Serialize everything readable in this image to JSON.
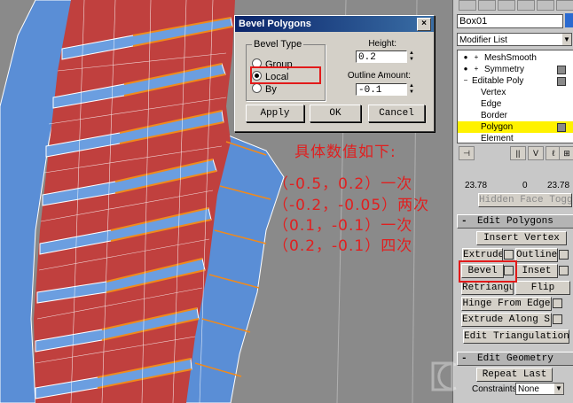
{
  "dialog": {
    "title": "Bevel Polygons",
    "close": "×",
    "bevel_type_legend": "Bevel Type",
    "options": [
      "Group",
      "Local",
      "By"
    ],
    "selected_option": "Local",
    "height_label": "Height:",
    "height_value": "0.2",
    "outline_label": "Outline Amount:",
    "outline_value": "-0.1",
    "apply": "Apply",
    "ok": "OK",
    "cancel": "Cancel"
  },
  "annotation": {
    "heading": "具体数值如下:",
    "lines": [
      "（-0.5，0.2）一次",
      "（-0.2，-0.05）两次",
      "（0.1，-0.1）一次",
      "（0.2，-0.1）四次"
    ]
  },
  "panel": {
    "object_name": "Box01",
    "object_color": "#2a6ad0",
    "modifier_list": "Modifier List",
    "stack": [
      {
        "label": "MeshSmooth",
        "selected": false
      },
      {
        "label": "Symmetry",
        "selected": false
      },
      {
        "label": "Editable Poly",
        "selected": false
      },
      {
        "label": "Vertex",
        "selected": false
      },
      {
        "label": "Edge",
        "selected": false
      },
      {
        "label": "Border",
        "selected": false
      },
      {
        "label": "Polygon",
        "selected": true
      },
      {
        "label": "Element",
        "selected": false
      }
    ],
    "numbers": [
      "23.78",
      "0",
      "23.78"
    ],
    "hidden_face_toggle": "Hidden Face Toggle",
    "edit_polygons": "Edit Polygons",
    "insert_vertex": "Insert Vertex",
    "extrude": "Extrude",
    "outline": "Outline",
    "bevel": "Bevel",
    "inset": "Inset",
    "retriangulate": "Retriangulate",
    "flip": "Flip",
    "hinge_from_edge": "Hinge From Edge",
    "extrude_along_spline": "Extrude Along Spline",
    "edit_triangulation": "Edit Triangulation",
    "edit_geometry": "Edit Geometry",
    "repeat_last": "Repeat Last",
    "constraints_label": "Constraints:",
    "constraints_value": "None",
    "rollout_minus": "-"
  },
  "colors": {
    "face_red": "#c0403e",
    "face_blue": "#5a8ed6",
    "edge_orange": "#f08a1c",
    "selection_yellow": "#fff200",
    "highlight_red": "#e21a1a"
  }
}
